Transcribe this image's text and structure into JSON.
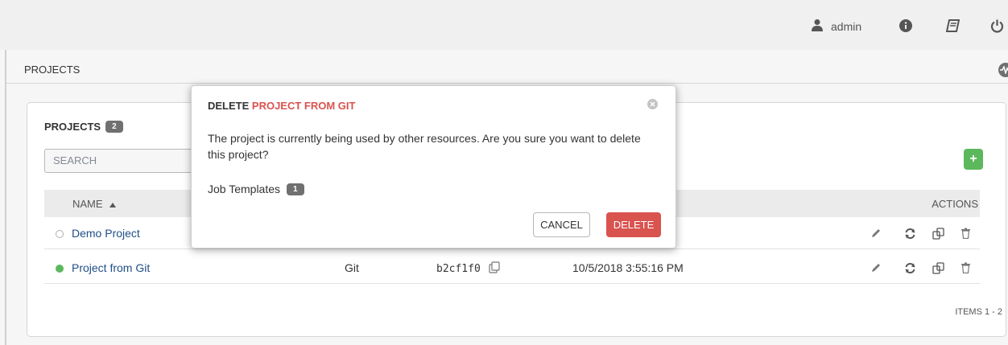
{
  "topbar": {
    "username": "admin",
    "icons": [
      "user-icon",
      "info-icon",
      "docs-icon",
      "power-icon"
    ]
  },
  "breadcrumb": {
    "label": "PROJECTS"
  },
  "panel": {
    "title": "PROJECTS",
    "count": "2",
    "search_placeholder": "SEARCH",
    "add_label": "+",
    "columns": {
      "name": "NAME",
      "actions": "ACTIONS"
    },
    "rows": [
      {
        "name": "Demo Project",
        "status_color": "#ffffff",
        "scm": "",
        "revision": "",
        "last_updated": ""
      },
      {
        "name": "Project from Git",
        "status_color": "#5cb85c",
        "scm": "Git",
        "revision": "b2cf1f0",
        "last_updated": "10/5/2018 3:55:16 PM"
      }
    ],
    "items_label": "ITEMS  1 - 2"
  },
  "modal": {
    "title_prefix": "DELETE ",
    "title_highlight": "PROJECT FROM GIT",
    "body": "The project is currently being used by other resources. Are you sure you want to delete this project?",
    "assoc_label": "Job Templates",
    "assoc_count": "1",
    "cancel_label": "CANCEL",
    "delete_label": "DELETE"
  },
  "colors": {
    "accent_red": "#d9534f",
    "link_blue": "#1f4e88",
    "success_green": "#5cb85c"
  }
}
